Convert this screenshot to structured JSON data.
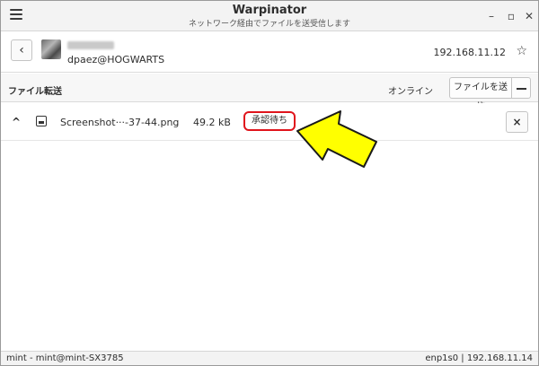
{
  "app": {
    "title": "Warpinator",
    "subtitle": "ネットワーク経由でファイルを送受信します"
  },
  "titlebar": {
    "menu_icon": "hamburger-menu-icon",
    "minimize": "–",
    "maximize": "▫",
    "close": "✕"
  },
  "header": {
    "back_label": "‹",
    "username": "dpaez@HOGWARTS",
    "ip": "192.168.11.12",
    "favorite_icon": "☆"
  },
  "toolbar": {
    "section_title": "ファイル転送",
    "status": "オンライン",
    "send_label": "ファイルを送信"
  },
  "transfers": [
    {
      "expand_icon": "^",
      "filename": "Screenshot···-37-44.png",
      "size": "49.2 kB",
      "state": "承認待ち",
      "cancel_label": "×"
    }
  ],
  "annotation": {
    "arrow_color": "#ffff00",
    "highlight_color": "#e0141c"
  },
  "statusbar": {
    "left": "mint - mint@mint-SX3785",
    "right": "enp1s0 | 192.168.11.14"
  }
}
